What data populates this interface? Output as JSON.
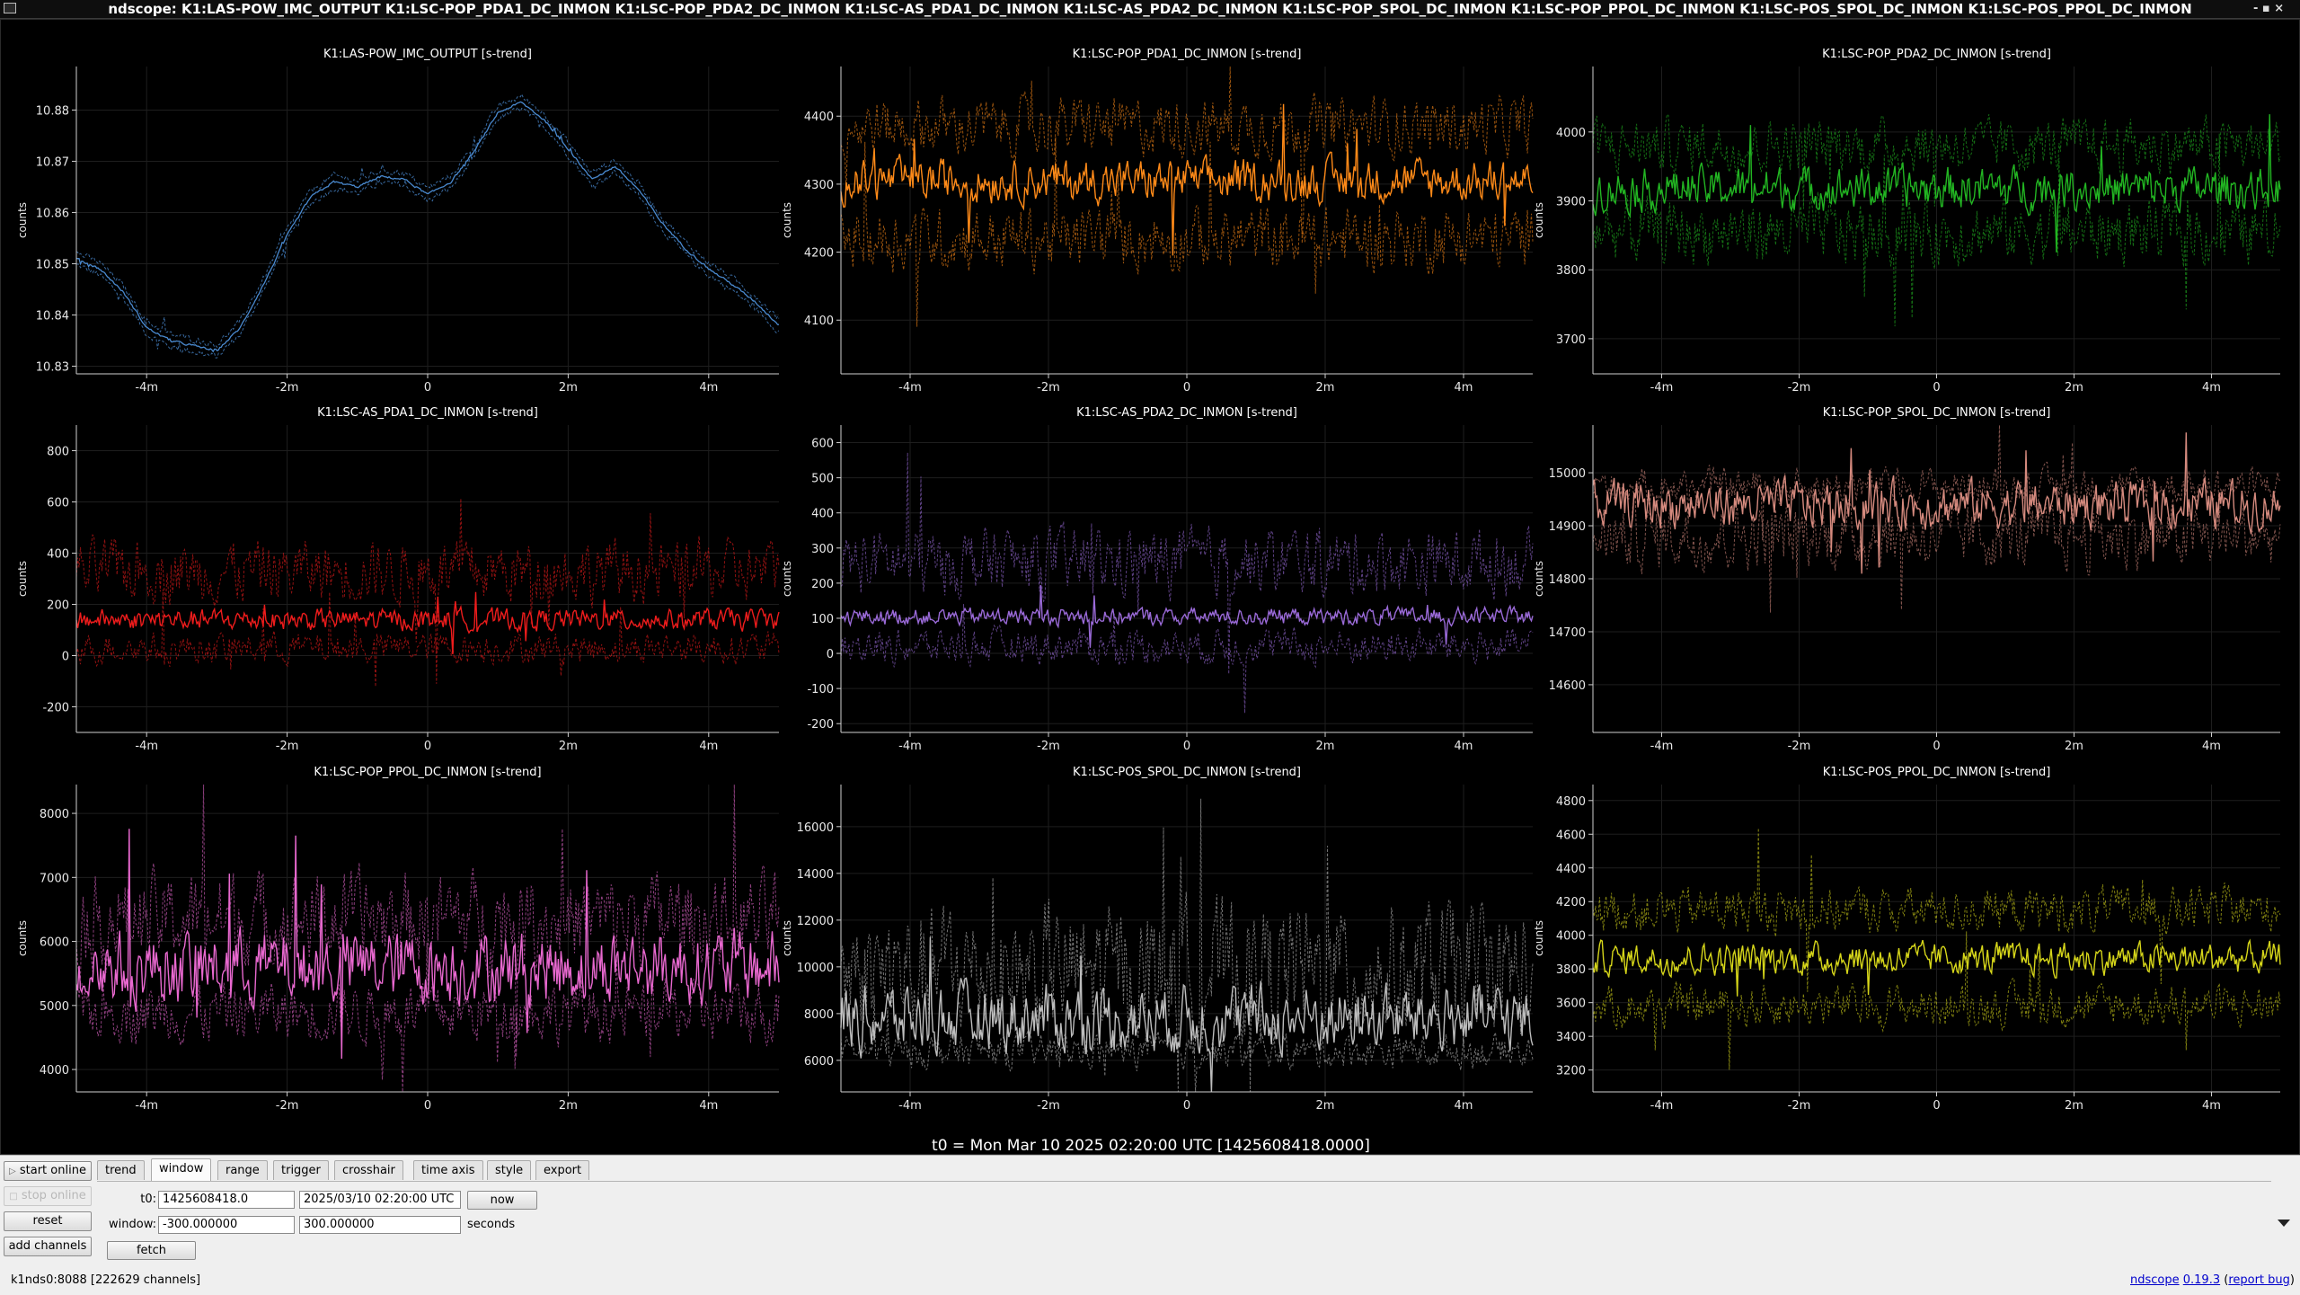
{
  "window": {
    "title": "ndscope: K1:LAS-POW_IMC_OUTPUT K1:LSC-POP_PDA1_DC_INMON K1:LSC-POP_PDA2_DC_INMON K1:LSC-AS_PDA1_DC_INMON K1:LSC-AS_PDA2_DC_INMON K1:LSC-POP_SPOL_DC_INMON K1:LSC-POP_PPOL_DC_INMON K1:LSC-POS_SPOL_DC_INMON K1:LSC-POS_PPOL_DC_INMON",
    "controls": "- ▪ ×"
  },
  "t0_label": "t0 = Mon Mar 10 2025 02:20:00 UTC [1425608418.0000]",
  "chart_data": [
    {
      "type": "line",
      "title": "K1:LAS-POW_IMC_OUTPUT [s-trend]",
      "ylabel": "counts",
      "color": "#4a8ad0",
      "xticks": [
        "-4m",
        "-2m",
        "0",
        "2m",
        "4m"
      ],
      "xlim": [
        -300,
        300
      ],
      "yticks": [
        10.83,
        10.84,
        10.85,
        10.86,
        10.87,
        10.88
      ],
      "ylim": [
        10.8285,
        10.8885
      ],
      "grid": true,
      "band": 0.0012,
      "series": [
        {
          "name": "mean",
          "x": [
            -300,
            -280,
            -260,
            -240,
            -220,
            -200,
            -180,
            -160,
            -140,
            -120,
            -100,
            -80,
            -60,
            -40,
            -20,
            0,
            20,
            40,
            60,
            80,
            100,
            120,
            140,
            160,
            180,
            200,
            220,
            240,
            260,
            280,
            300
          ],
          "y": [
            10.851,
            10.849,
            10.8445,
            10.8375,
            10.835,
            10.834,
            10.833,
            10.8375,
            10.846,
            10.8555,
            10.863,
            10.866,
            10.865,
            10.867,
            10.8665,
            10.8635,
            10.866,
            10.872,
            10.8795,
            10.8815,
            10.878,
            10.8725,
            10.8665,
            10.869,
            10.8645,
            10.858,
            10.853,
            10.849,
            10.846,
            10.8425,
            10.838
          ]
        }
      ]
    },
    {
      "type": "line",
      "title": "K1:LSC-POP_PDA1_DC_INMON [s-trend]",
      "ylabel": "counts",
      "color": "#ff8a18",
      "xticks": [
        "-4m",
        "-2m",
        "0",
        "2m",
        "4m"
      ],
      "xlim": [
        -300,
        300
      ],
      "yticks": [
        4100,
        4200,
        4300,
        4400
      ],
      "ylim": [
        4021,
        4473
      ],
      "grid": true,
      "series": [
        {
          "name": "mean",
          "base": 4305,
          "amp": 28
        },
        {
          "name": "max",
          "base": 4385,
          "amp": 38
        },
        {
          "name": "min",
          "base": 4220,
          "amp": 42
        }
      ]
    },
    {
      "type": "line",
      "title": "K1:LSC-POP_PDA2_DC_INMON [s-trend]",
      "ylabel": "counts",
      "color": "#22b522",
      "xticks": [
        "-4m",
        "-2m",
        "0",
        "2m",
        "4m"
      ],
      "xlim": [
        -300,
        300
      ],
      "yticks": [
        3700,
        3800,
        3900,
        4000
      ],
      "ylim": [
        3649,
        4095
      ],
      "grid": true,
      "series": [
        {
          "name": "mean",
          "base": 3918,
          "amp": 28
        },
        {
          "name": "max",
          "base": 3980,
          "amp": 35
        },
        {
          "name": "min",
          "base": 3855,
          "amp": 42
        }
      ]
    },
    {
      "type": "line",
      "title": "K1:LSC-AS_PDA1_DC_INMON [s-trend]",
      "ylabel": "counts",
      "color": "#ee1c1c",
      "xticks": [
        "-4m",
        "-2m",
        "0",
        "2m",
        "4m"
      ],
      "xlim": [
        -300,
        300
      ],
      "yticks": [
        -200,
        0,
        200,
        400,
        600,
        800
      ],
      "ylim": [
        -300,
        900
      ],
      "grid": true,
      "series": [
        {
          "name": "mean",
          "base": 140,
          "amp": 38
        },
        {
          "name": "max",
          "base": 330,
          "amp": 110
        },
        {
          "name": "min",
          "base": 30,
          "amp": 55
        }
      ]
    },
    {
      "type": "line",
      "title": "K1:LSC-AS_PDA2_DC_INMON [s-trend]",
      "ylabel": "counts",
      "color": "#9a6ad8",
      "xticks": [
        "-4m",
        "-2m",
        "0",
        "2m",
        "4m"
      ],
      "xlim": [
        -300,
        300
      ],
      "yticks": [
        -200,
        -100,
        0,
        100,
        200,
        300,
        400,
        500,
        600
      ],
      "ylim": [
        -225,
        650
      ],
      "grid": true,
      "series": [
        {
          "name": "mean",
          "base": 105,
          "amp": 22
        },
        {
          "name": "max",
          "base": 260,
          "amp": 85
        },
        {
          "name": "min",
          "base": 20,
          "amp": 45
        }
      ]
    },
    {
      "type": "line",
      "title": "K1:LSC-POP_SPOL_DC_INMON [s-trend]",
      "ylabel": "counts",
      "color": "#d58a7e",
      "xticks": [
        "-4m",
        "-2m",
        "0",
        "2m",
        "4m"
      ],
      "xlim": [
        -300,
        300
      ],
      "yticks": [
        14600,
        14700,
        14800,
        14900,
        15000
      ],
      "ylim": [
        14510,
        15090
      ],
      "grid": true,
      "series": [
        {
          "name": "mean",
          "base": 14940,
          "amp": 40
        },
        {
          "name": "max",
          "base": 14975,
          "amp": 30
        },
        {
          "name": "min",
          "base": 14880,
          "amp": 55
        }
      ]
    },
    {
      "type": "line",
      "title": "K1:LSC-POP_PPOL_DC_INMON [s-trend]",
      "ylabel": "counts",
      "color": "#e868cf",
      "xticks": [
        "-4m",
        "-2m",
        "0",
        "2m",
        "4m"
      ],
      "xlim": [
        -300,
        300
      ],
      "yticks": [
        4000,
        5000,
        6000,
        7000,
        8000
      ],
      "ylim": [
        3650,
        8450
      ],
      "grid": true,
      "series": [
        {
          "name": "mean",
          "base": 5600,
          "amp": 520
        },
        {
          "name": "max",
          "base": 6350,
          "amp": 650
        },
        {
          "name": "min",
          "base": 4900,
          "amp": 420
        }
      ]
    },
    {
      "type": "line",
      "title": "K1:LSC-POS_SPOL_DC_INMON [s-trend]",
      "ylabel": "counts",
      "color": "#bdbdbd",
      "xticks": [
        "-4m",
        "-2m",
        "0",
        "2m",
        "4m"
      ],
      "xlim": [
        -300,
        300
      ],
      "yticks": [
        6000,
        8000,
        10000,
        12000,
        14000,
        16000
      ],
      "ylim": [
        4650,
        17800
      ],
      "grid": true,
      "series": [
        {
          "name": "mean",
          "base": 7800,
          "amp": 1300
        },
        {
          "name": "max",
          "base": 9800,
          "amp": 2600
        },
        {
          "name": "min",
          "base": 6400,
          "amp": 650
        }
      ]
    },
    {
      "type": "line",
      "title": "K1:LSC-POS_PPOL_DC_INMON [s-trend]",
      "ylabel": "counts",
      "color": "#d6d61a",
      "xticks": [
        "-4m",
        "-2m",
        "0",
        "2m",
        "4m"
      ],
      "xlim": [
        -300,
        300
      ],
      "yticks": [
        3200,
        3400,
        3600,
        3800,
        4000,
        4200,
        4400,
        4600,
        4800
      ],
      "ylim": [
        3070,
        4895
      ],
      "grid": true,
      "series": [
        {
          "name": "mean",
          "base": 3860,
          "amp": 85
        },
        {
          "name": "max",
          "base": 4150,
          "amp": 120
        },
        {
          "name": "min",
          "base": 3580,
          "amp": 110
        }
      ]
    }
  ],
  "side_buttons": {
    "start_online": "start online",
    "stop_online": "stop online",
    "reset": "reset",
    "add_channels": "add channels",
    "fetch": "fetch"
  },
  "tabs": [
    "trend",
    "window",
    "range",
    "trigger",
    "crosshair",
    "time axis",
    "style",
    "export"
  ],
  "window_tab": {
    "t0_label": "t0:",
    "t0_gps": "1425608418.0",
    "t0_utc": "2025/03/10 02:20:00 UTC",
    "now": "now",
    "window_label": "window:",
    "window_start": "-300.000000",
    "window_end": "300.000000",
    "units": "seconds"
  },
  "status": "k1nds0:8088  [222629 channels]",
  "links": {
    "app": "ndscope",
    "version": "0.19.3",
    "report": "report bug"
  }
}
